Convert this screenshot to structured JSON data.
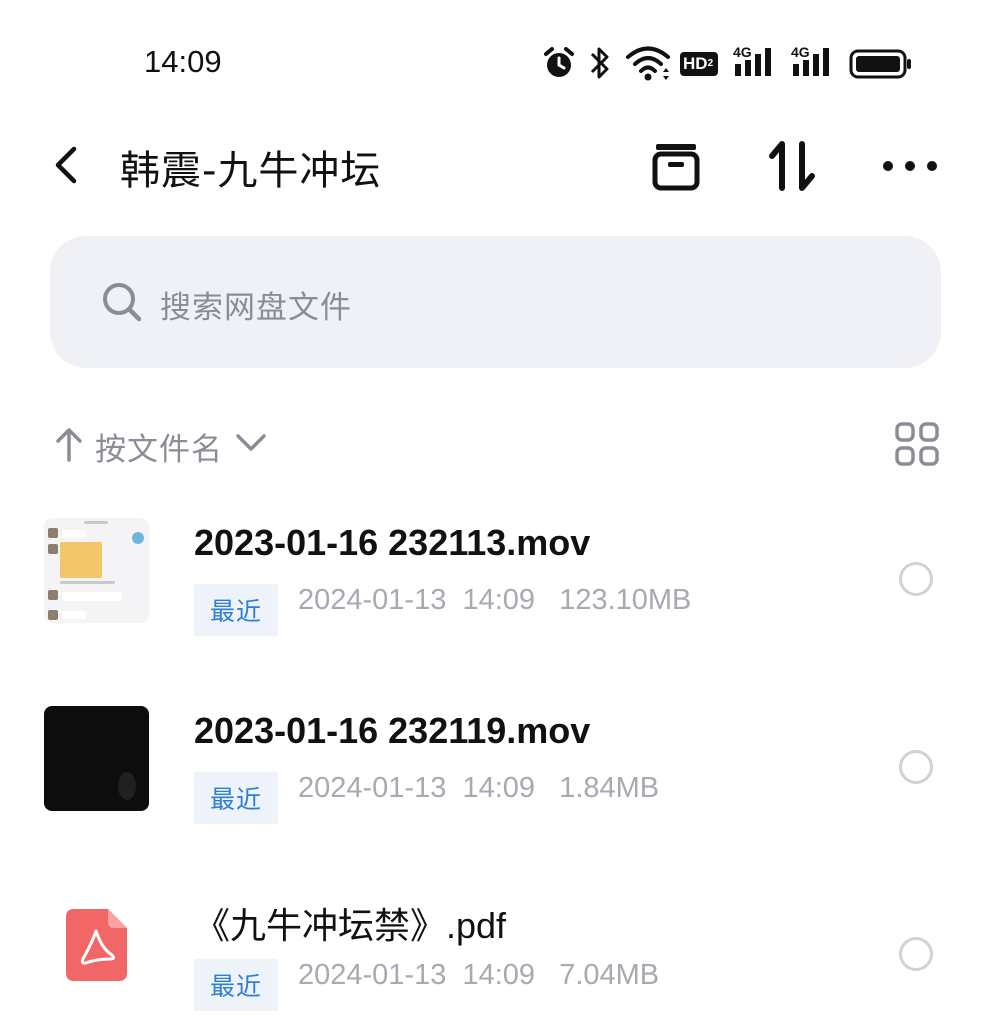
{
  "status_bar": {
    "time": "14:09",
    "icons": [
      "alarm-icon",
      "bluetooth-icon",
      "wifi-icon",
      "hd-icon",
      "signal-4g-icon",
      "signal-4g-icon",
      "battery-icon"
    ],
    "hd_label": "HD",
    "hd_sub": "2",
    "net_label": "4G"
  },
  "header": {
    "title": "韩震-九牛冲坛",
    "icons": [
      "back-icon",
      "archive-icon",
      "transfer-icon",
      "more-icon"
    ]
  },
  "search": {
    "placeholder": "搜索网盘文件",
    "icon": "search-icon"
  },
  "sort": {
    "label": "按文件名",
    "direction_icon": "arrow-up-icon",
    "dropdown_icon": "chevron-down-icon",
    "view_icon": "grid-view-icon"
  },
  "files": [
    {
      "name": "2023-01-16 232113.mov",
      "badge": "最近",
      "meta": "2024-01-13  14:09   123.10MB",
      "thumb": "chat-screenshot-thumbnail"
    },
    {
      "name": "2023-01-16 232119.mov",
      "badge": "最近",
      "meta": "2024-01-13  14:09   1.84MB",
      "thumb": "dark-video-thumbnail"
    },
    {
      "name": "《九牛冲坛禁》.pdf",
      "badge": "最近",
      "meta": "2024-01-13  14:09   7.04MB",
      "thumb": "pdf-icon"
    }
  ],
  "colors": {
    "search_bg": "#eff1f6",
    "badge_bg": "#eef3f9",
    "badge_text": "#2d7fd3",
    "meta_text": "#a7aab1",
    "pdf_red": "#f16768"
  }
}
